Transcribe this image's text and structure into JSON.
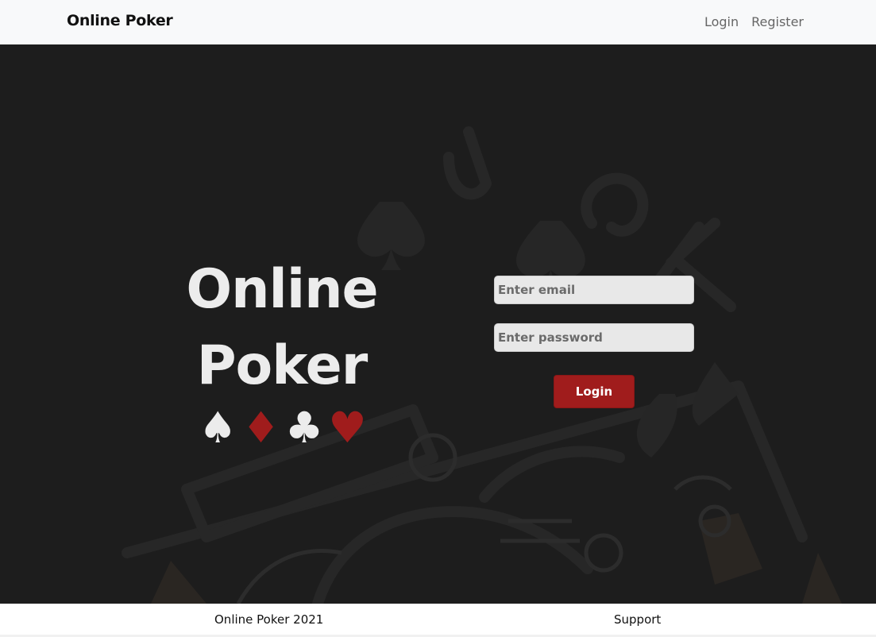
{
  "navbar": {
    "brand": "Online Poker",
    "links": [
      "Login",
      "Register"
    ]
  },
  "hero": {
    "title_line1": "Online",
    "title_line2": "Poker",
    "suits": [
      {
        "glyph": "♠",
        "color": "#ececec",
        "icon": "spade-icon"
      },
      {
        "glyph": "♦",
        "color": "#a01c1c",
        "icon": "diamond-icon"
      },
      {
        "glyph": "♣",
        "color": "#ececec",
        "icon": "club-icon"
      },
      {
        "glyph": "♥",
        "color": "#a01c1c",
        "icon": "heart-icon"
      }
    ]
  },
  "login_form": {
    "email_placeholder": "Enter email",
    "password_placeholder": "Enter password",
    "submit_label": "Login"
  },
  "footer": {
    "copyright": "Online Poker 2021",
    "support": "Support"
  },
  "colors": {
    "accent": "#a01c1c",
    "hero_background": "#1d1d1d",
    "navbar_background": "#f8f9fa"
  }
}
